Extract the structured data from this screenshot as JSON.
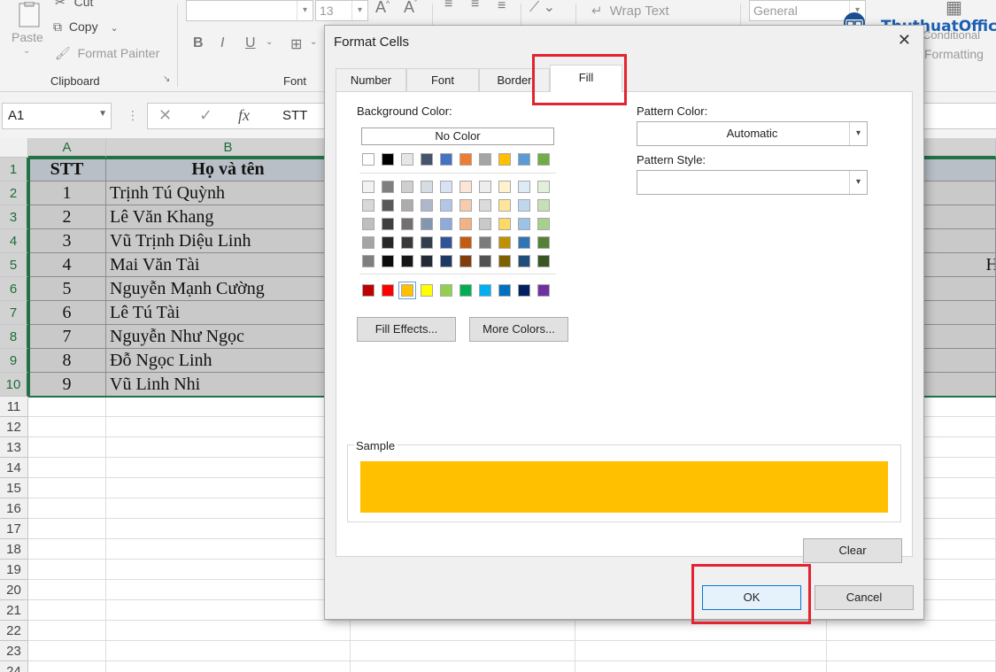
{
  "ribbon": {
    "paste": "Paste",
    "cut": "Cut",
    "copy": "Copy",
    "format_painter": "Format Painter",
    "clipboard_group": "Clipboard",
    "font_size": "13",
    "font_group": "Font",
    "bold": "B",
    "italic": "I",
    "underline": "U",
    "wrap_text": "Wrap Text",
    "number_format": "General",
    "conditional": "Conditional",
    "formatting": "Formatting",
    "logo_text": "ThuthuatOffice"
  },
  "formula_bar": {
    "name_box": "A1",
    "cancel": "✕",
    "enter": "✓",
    "fx": "fx",
    "value": "STT"
  },
  "sheet": {
    "columns": [
      "A",
      "B"
    ],
    "rows": [
      "1",
      "2",
      "3",
      "4",
      "5",
      "6",
      "7",
      "8",
      "9",
      "10",
      "11",
      "12",
      "13",
      "14",
      "15",
      "16",
      "17",
      "18",
      "19",
      "20",
      "21",
      "22",
      "23",
      "24"
    ],
    "header": {
      "stt": "STT",
      "name": "Họ và tên"
    },
    "data": [
      {
        "stt": "1",
        "name": "Trịnh Tú Quỳnh"
      },
      {
        "stt": "2",
        "name": "Lê Văn Khang"
      },
      {
        "stt": "3",
        "name": "Vũ Trịnh Diệu Linh"
      },
      {
        "stt": "4",
        "name": "Mai Văn Tài"
      },
      {
        "stt": "5",
        "name": "Nguyễn Mạnh Cường"
      },
      {
        "stt": "6",
        "name": "Lê Tú Tài"
      },
      {
        "stt": "7",
        "name": "Nguyễn Như Ngọc"
      },
      {
        "stt": "8",
        "name": "Đỗ Ngọc Linh"
      },
      {
        "stt": "9",
        "name": "Vũ Linh Nhi"
      }
    ],
    "fragment_row5": "H"
  },
  "dialog": {
    "title": "Format Cells",
    "close": "✕",
    "tabs": [
      "Number",
      "Font",
      "Border",
      "Fill"
    ],
    "active_tab": "Fill",
    "background_color_label": "Background Color:",
    "no_color": "No Color",
    "palette_top": [
      "#ffffff",
      "#000000",
      "#e7e6e6",
      "#44546a",
      "#4472c4",
      "#ed7d31",
      "#a5a5a5",
      "#ffc000",
      "#5b9bd5",
      "#70ad47"
    ],
    "palette_shades": [
      [
        "#f2f2f2",
        "#7f7f7f",
        "#d0cece",
        "#d6dce4",
        "#d9e2f3",
        "#fbe5d5",
        "#ededed",
        "#fff2cc",
        "#deebf6",
        "#e2efd9"
      ],
      [
        "#d8d8d8",
        "#595959",
        "#aeabab",
        "#adb9ca",
        "#b4c6e7",
        "#f7cbac",
        "#dbdbdb",
        "#fee599",
        "#bdd7ee",
        "#c5e0b3"
      ],
      [
        "#bfbfbf",
        "#3f3f3f",
        "#757070",
        "#8496b0",
        "#8eaadb",
        "#f4b183",
        "#c9c9c9",
        "#ffd966",
        "#9cc3e5",
        "#a8d08d"
      ],
      [
        "#a5a5a5",
        "#262626",
        "#3a3838",
        "#323f4f",
        "#2f5496",
        "#c55a11",
        "#7b7b7b",
        "#bf9000",
        "#2e75b5",
        "#538135"
      ],
      [
        "#7f7f7f",
        "#0c0c0c",
        "#171616",
        "#222a35",
        "#1f3864",
        "#833c0b",
        "#525252",
        "#7f6000",
        "#1e4e79",
        "#375623"
      ]
    ],
    "palette_standard": [
      "#c00000",
      "#ff0000",
      "#ffc000",
      "#ffff00",
      "#92d050",
      "#00b050",
      "#00b0f0",
      "#0070c0",
      "#002060",
      "#7030a0"
    ],
    "selected_color": "#ffc000",
    "fill_effects": "Fill Effects...",
    "more_colors": "More Colors...",
    "pattern_color_label": "Pattern Color:",
    "pattern_color_value": "Automatic",
    "pattern_style_label": "Pattern Style:",
    "pattern_style_value": "",
    "sample_label": "Sample",
    "clear": "Clear",
    "ok": "OK",
    "cancel": "Cancel",
    "highlight_color": "#e3232f"
  }
}
